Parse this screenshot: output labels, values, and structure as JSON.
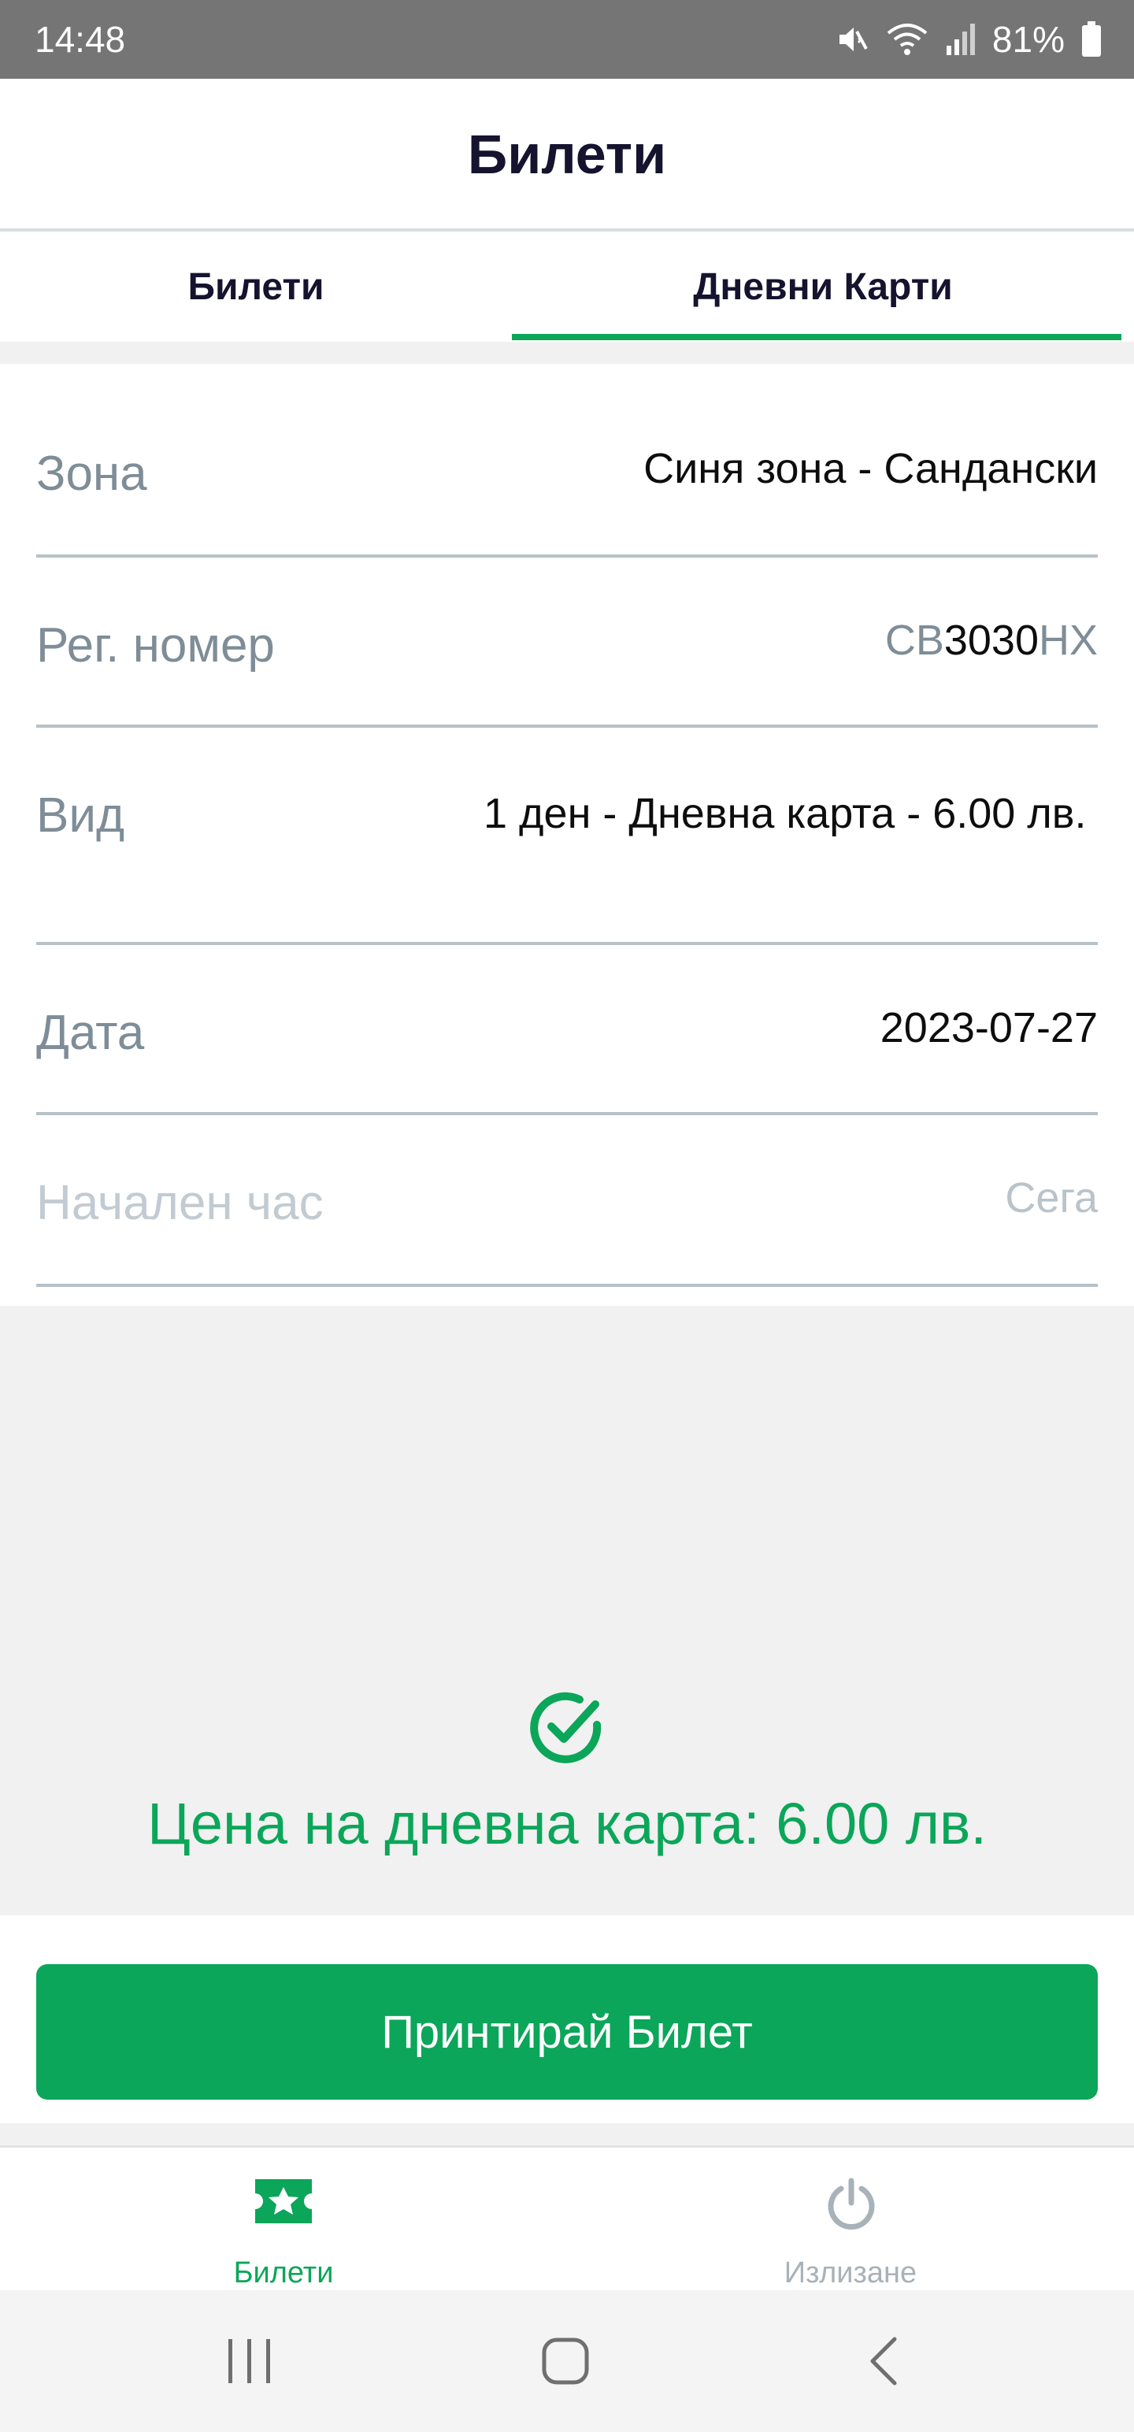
{
  "status_bar": {
    "time": "14:48",
    "battery": "81%",
    "icons": [
      "mute-icon",
      "wifi-icon",
      "signal-icon",
      "battery-icon"
    ]
  },
  "header": {
    "title": "Билети"
  },
  "tabs": [
    {
      "label": "Билети",
      "active": false
    },
    {
      "label": "Дневни Карти",
      "active": true
    }
  ],
  "form": {
    "zone": {
      "label": "Зона",
      "value": "Синя зона - Сандански"
    },
    "reg_number": {
      "label": "Рег. номер",
      "prefix": "СВ",
      "digits": "3030",
      "suffix": "НХ"
    },
    "type": {
      "label": "Вид",
      "value": "1 ден - Дневна карта - 6.00 лв."
    },
    "date": {
      "label": "Дата",
      "value": "2023-07-27"
    },
    "start_time": {
      "label": "Начален час",
      "value": "Сега"
    }
  },
  "price": {
    "text": "Цена на дневна карта: 6.00 лв.",
    "icon": "check-circle-icon"
  },
  "actions": {
    "print_label": "Принтирай Билет"
  },
  "bottom_nav": [
    {
      "label": "Билети",
      "icon": "ticket-star-icon",
      "active": true
    },
    {
      "label": "Излизане",
      "icon": "power-icon",
      "active": false
    }
  ],
  "colors": {
    "accent": "#0ba659",
    "title_text": "#15132e",
    "label_gray": "#7e8d97",
    "status_bar": "#757575"
  }
}
